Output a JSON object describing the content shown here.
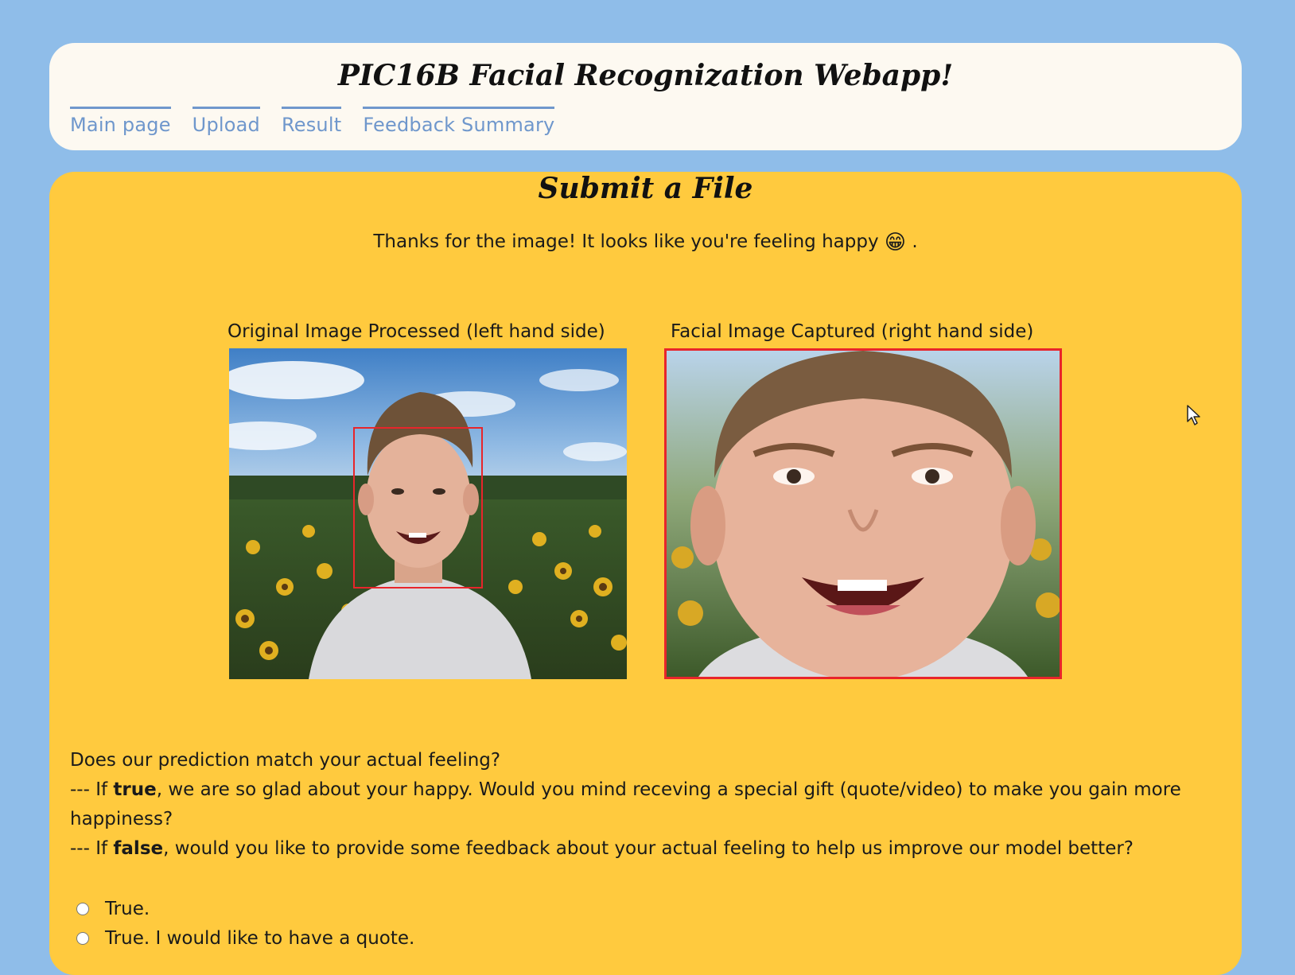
{
  "header": {
    "title": "PIC16B Facial Recognization Webapp!",
    "nav": [
      {
        "label": "Main page"
      },
      {
        "label": "Upload"
      },
      {
        "label": "Result"
      },
      {
        "label": "Feedback Summary"
      }
    ]
  },
  "main": {
    "title": "Submit a File",
    "message_prefix": "Thanks for the image! It looks like you're feeling happy",
    "message_emoji": "😁",
    "message_suffix": ".",
    "left_caption": "Original Image Processed (left hand side)",
    "right_caption": "Facial Image Captured (right hand side)",
    "question": "Does our prediction match your actual feeling?",
    "true_line": {
      "prefix": "--- If",
      "keyword": "true",
      "rest": ", we are so glad about your happy. Would you mind receving a special gift (quote/video) to make you gain more happiness?"
    },
    "false_line": {
      "prefix": "--- If",
      "keyword": "false",
      "rest": ", would you like to provide some feedback about your actual feeling to help us improve our model better?"
    },
    "options": [
      {
        "label": "True."
      },
      {
        "label": "True. I would like to have a quote."
      }
    ]
  },
  "colors": {
    "page_background": "#8fbde9",
    "header_background": "#fdf9f1",
    "panel_background": "#ffca3e",
    "nav_link": "#6f97cc",
    "face_box": "#e8252b"
  }
}
